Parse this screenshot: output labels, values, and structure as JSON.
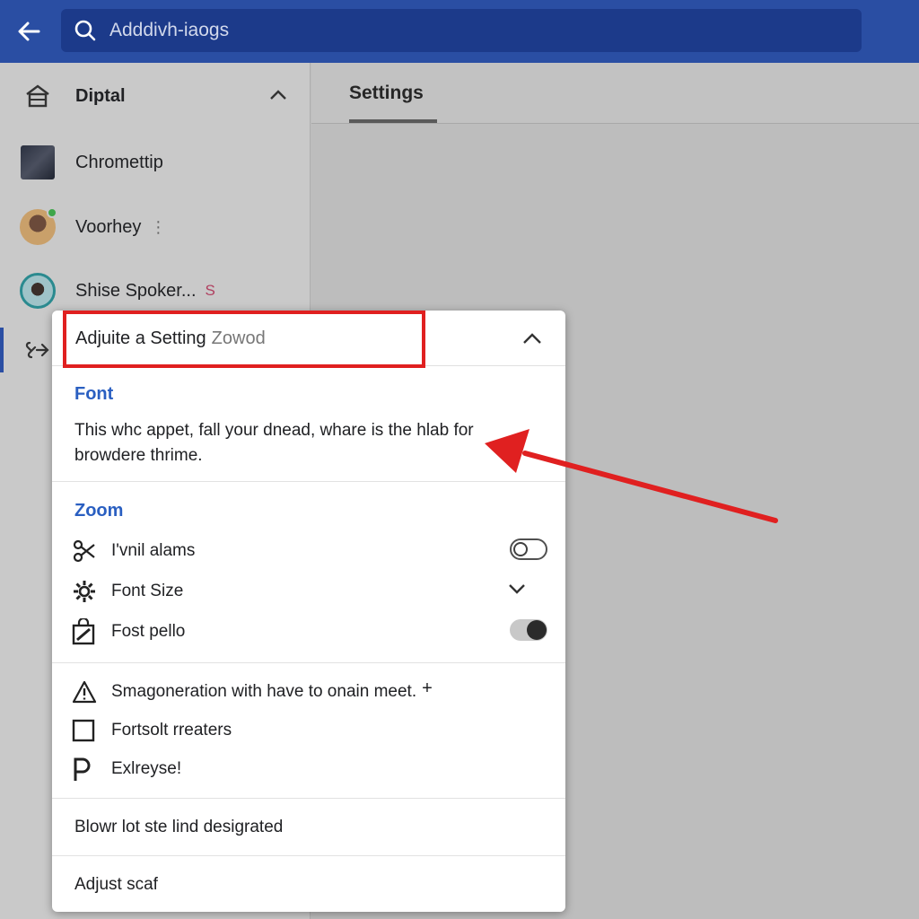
{
  "topbar": {
    "search_value": "Adddivh-iaogs",
    "back_icon": "arrow-left-icon",
    "search_icon": "search-icon"
  },
  "sidebar": {
    "items": [
      {
        "label": "Diptal",
        "icon": "home-icon"
      },
      {
        "label": "Chromettip"
      },
      {
        "label": "Voorhey",
        "suffix": "⋮"
      },
      {
        "label": "Shise Spoker...",
        "suffix": "S"
      },
      {
        "label": "",
        "icon": "link-icon"
      }
    ]
  },
  "tabs": {
    "settings": "Settings"
  },
  "panel": {
    "title_strong": "Adjuite a Setting",
    "title_faint": "Zowod",
    "font_section": {
      "title": "Font",
      "description": "This whc appet, fall your dnead, whare is the hlab for browdere thrime."
    },
    "zoom_section": {
      "title": "Zoom",
      "rows": [
        {
          "label": "I'vnil alams",
          "icon": "scissors-icon",
          "control": "toggle",
          "state": "off"
        },
        {
          "label": "Font Size",
          "icon": "gear-icon",
          "control": "chevron-down"
        },
        {
          "label": "Fost pello",
          "icon": "bag-icon",
          "control": "toggle",
          "state": "on"
        }
      ]
    },
    "extras": [
      {
        "label": "Smagoneration with have to onain meet.",
        "icon": "warning-icon",
        "suffix": "+"
      },
      {
        "label": "Fortsolt rreaters",
        "icon": "checkbox-icon"
      },
      {
        "label": "Exlreyse!",
        "icon": "p-icon"
      }
    ],
    "footer_rows": [
      "Blowr lot ste lind desigrated",
      "Adjust scaf"
    ]
  },
  "colors": {
    "topbar": "#2a4ea3",
    "accent_text": "#2a5fc1",
    "highlight_red": "#e02020"
  }
}
